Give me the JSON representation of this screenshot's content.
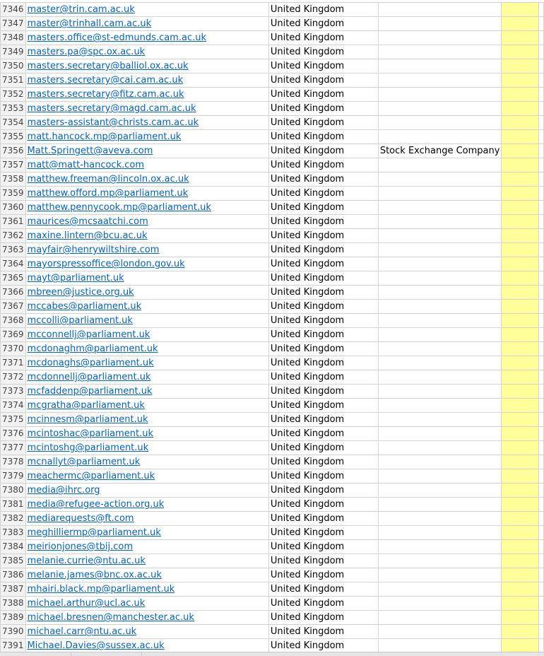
{
  "sheet": {
    "rows": [
      {
        "n": "7346",
        "email": "master@trin.cam.ac.uk",
        "country": "United Kingdom",
        "note": ""
      },
      {
        "n": "7347",
        "email": "master@trinhall.cam.ac.uk",
        "country": "United Kingdom",
        "note": ""
      },
      {
        "n": "7348",
        "email": "masters.office@st-edmunds.cam.ac.uk",
        "country": "United Kingdom",
        "note": ""
      },
      {
        "n": "7349",
        "email": "masters.pa@spc.ox.ac.uk",
        "country": "United Kingdom",
        "note": ""
      },
      {
        "n": "7350",
        "email": "masters.secretary@balliol.ox.ac.uk",
        "country": "United Kingdom",
        "note": ""
      },
      {
        "n": "7351",
        "email": "masters.secretary@cai.cam.ac.uk",
        "country": "United Kingdom",
        "note": ""
      },
      {
        "n": "7352",
        "email": "masters.secretary@fitz.cam.ac.uk",
        "country": "United Kingdom",
        "note": ""
      },
      {
        "n": "7353",
        "email": "masters.secretary@magd.cam.ac.uk",
        "country": "United Kingdom",
        "note": ""
      },
      {
        "n": "7354",
        "email": "masters-assistant@christs.cam.ac.uk",
        "country": "United Kingdom",
        "note": ""
      },
      {
        "n": "7355",
        "email": "matt.hancock.mp@parliament.uk",
        "country": "United Kingdom",
        "note": ""
      },
      {
        "n": "7356",
        "email": "Matt.Springett@aveva.com",
        "country": "United Kingdom",
        "note": "Stock Exchange Company"
      },
      {
        "n": "7357",
        "email": "matt@matt-hancock.com",
        "country": "United Kingdom",
        "note": ""
      },
      {
        "n": "7358",
        "email": "matthew.freeman@lincoln.ox.ac.uk",
        "country": "United Kingdom",
        "note": ""
      },
      {
        "n": "7359",
        "email": "matthew.offord.mp@parliament.uk",
        "country": "United Kingdom",
        "note": ""
      },
      {
        "n": "7360",
        "email": "matthew.pennycook.mp@parliament.uk",
        "country": "United Kingdom",
        "note": ""
      },
      {
        "n": "7361",
        "email": "maurices@mcsaatchi.com",
        "country": "United Kingdom",
        "note": ""
      },
      {
        "n": "7362",
        "email": "maxine.lintern@bcu.ac.uk",
        "country": "United Kingdom",
        "note": ""
      },
      {
        "n": "7363",
        "email": "mayfair@henrywiltshire.com",
        "country": "United Kingdom",
        "note": ""
      },
      {
        "n": "7364",
        "email": "mayorspressoffice@london.gov.uk",
        "country": "United Kingdom",
        "note": ""
      },
      {
        "n": "7365",
        "email": "mayt@parliament.uk",
        "country": "United Kingdom",
        "note": ""
      },
      {
        "n": "7366",
        "email": "mbreen@justice.org.uk",
        "country": "United Kingdom",
        "note": ""
      },
      {
        "n": "7367",
        "email": "mccabes@parliament.uk",
        "country": "United Kingdom",
        "note": ""
      },
      {
        "n": "7368",
        "email": "mccolli@parliament.uk",
        "country": "United Kingdom",
        "note": ""
      },
      {
        "n": "7369",
        "email": "mcconnellj@parliament.uk",
        "country": "United Kingdom",
        "note": ""
      },
      {
        "n": "7370",
        "email": "mcdonaghm@parliament.uk",
        "country": "United Kingdom",
        "note": ""
      },
      {
        "n": "7371",
        "email": "mcdonaghs@parliament.uk",
        "country": "United Kingdom",
        "note": ""
      },
      {
        "n": "7372",
        "email": "mcdonnellj@parliament.uk",
        "country": "United Kingdom",
        "note": ""
      },
      {
        "n": "7373",
        "email": "mcfaddenp@parliament.uk",
        "country": "United Kingdom",
        "note": ""
      },
      {
        "n": "7374",
        "email": "mcgratha@parliament.uk",
        "country": "United Kingdom",
        "note": ""
      },
      {
        "n": "7375",
        "email": "mcinnesm@parliament.uk",
        "country": "United Kingdom",
        "note": ""
      },
      {
        "n": "7376",
        "email": "mcintoshac@parliament.uk",
        "country": "United Kingdom",
        "note": ""
      },
      {
        "n": "7377",
        "email": "mcintoshg@parliament.uk",
        "country": "United Kingdom",
        "note": ""
      },
      {
        "n": "7378",
        "email": "mcnallyt@parliament.uk",
        "country": "United Kingdom",
        "note": ""
      },
      {
        "n": "7379",
        "email": "meachermc@parliament.uk",
        "country": "United Kingdom",
        "note": ""
      },
      {
        "n": "7380",
        "email": "media@ihrc.org",
        "country": "United Kingdom",
        "note": ""
      },
      {
        "n": "7381",
        "email": "media@refugee-action.org.uk",
        "country": "United Kingdom",
        "note": ""
      },
      {
        "n": "7382",
        "email": "mediarequests@ft.com",
        "country": "United Kingdom",
        "note": ""
      },
      {
        "n": "7383",
        "email": "meghilliermp@parliament.uk",
        "country": "United Kingdom",
        "note": ""
      },
      {
        "n": "7384",
        "email": "meirionjones@tbij.com",
        "country": "United Kingdom",
        "note": ""
      },
      {
        "n": "7385",
        "email": "melanie.currie@ntu.ac.uk",
        "country": "United Kingdom",
        "note": ""
      },
      {
        "n": "7386",
        "email": "melanie.james@bnc.ox.ac.uk",
        "country": "United Kingdom",
        "note": ""
      },
      {
        "n": "7387",
        "email": "mhairi.black.mp@parliament.uk",
        "country": "United Kingdom",
        "note": ""
      },
      {
        "n": "7388",
        "email": "michael.arthur@ucl.ac.uk",
        "country": "United Kingdom",
        "note": ""
      },
      {
        "n": "7389",
        "email": "michael.bresnen@manchester.ac.uk",
        "country": "United Kingdom",
        "note": ""
      },
      {
        "n": "7390",
        "email": "michael.carr@ntu.ac.uk",
        "country": "United Kingdom",
        "note": ""
      },
      {
        "n": "7391",
        "email": "Michael.Davies@sussex.ac.uk",
        "country": "United Kingdom",
        "note": ""
      }
    ]
  },
  "colors": {
    "link": "#0563c1",
    "highlight": "#ffff99",
    "gridline": "#d4d4d4",
    "rowheader_bg": "#f2f2f2"
  }
}
